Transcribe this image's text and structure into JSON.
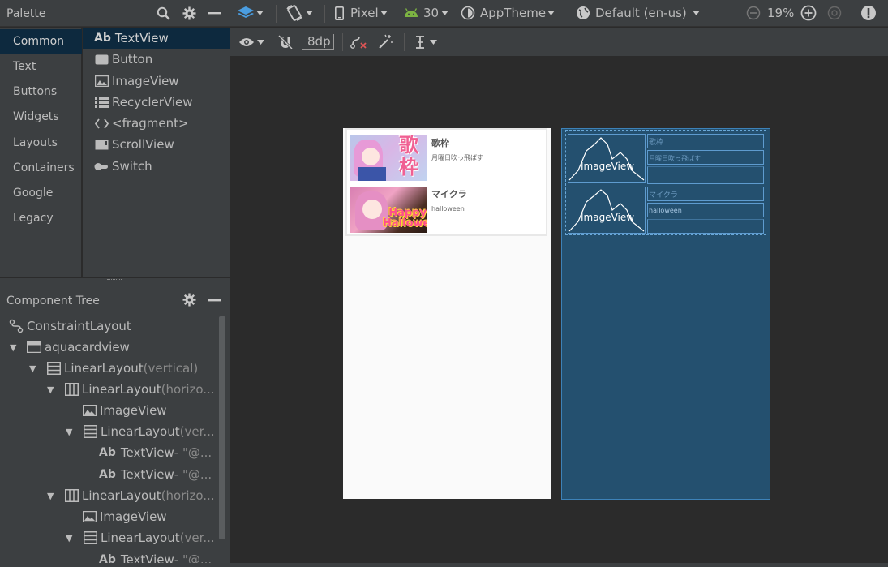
{
  "palette": {
    "title": "Palette",
    "categories": [
      "Common",
      "Text",
      "Buttons",
      "Widgets",
      "Layouts",
      "Containers",
      "Google",
      "Legacy"
    ],
    "items": [
      {
        "icon": "textview-icon",
        "prefix": "Ab",
        "label": "TextView"
      },
      {
        "icon": "button-icon",
        "label": "Button"
      },
      {
        "icon": "imageview-icon",
        "label": "ImageView"
      },
      {
        "icon": "recyclerview-icon",
        "label": "RecyclerView"
      },
      {
        "icon": "fragment-icon",
        "label": "<fragment>"
      },
      {
        "icon": "scrollview-icon",
        "label": "ScrollView"
      },
      {
        "icon": "switch-icon",
        "label": "Switch"
      }
    ]
  },
  "component_tree": {
    "title": "Component Tree",
    "rows": [
      {
        "label": "ConstraintLayout",
        "dim": ""
      },
      {
        "label": "aquacardview",
        "dim": ""
      },
      {
        "label": "LinearLayout",
        "dim": "(vertical)"
      },
      {
        "label": "LinearLayout",
        "dim": "(horizo..."
      },
      {
        "label": "ImageView",
        "dim": ""
      },
      {
        "label": "LinearLayout",
        "dim": "(ver..."
      },
      {
        "label": "TextView",
        "dim": "- \"@..."
      },
      {
        "label": "TextView",
        "dim": "- \"@..."
      },
      {
        "label": "LinearLayout",
        "dim": "(horizo..."
      },
      {
        "label": "ImageView",
        "dim": ""
      },
      {
        "label": "LinearLayout",
        "dim": "(ver..."
      },
      {
        "label": "TextView",
        "dim": "- \"@..."
      }
    ],
    "text_prefix": "Ab"
  },
  "toolbar": {
    "device": "Pixel",
    "api": "30",
    "theme": "AppTheme",
    "locale": "Default (en-us)",
    "zoom": "19%",
    "margin": "8dp"
  },
  "preview": {
    "cards": [
      {
        "title": "歌枠",
        "subtitle": "月曜日吹っ飛ばす",
        "thumb_text": "歌\n枠"
      },
      {
        "title": "マイクラ",
        "subtitle": "halloween",
        "thumb_text": "Happy\nHalloween"
      }
    ]
  },
  "blueprint": {
    "image_label": "ImageView",
    "cards": [
      {
        "title": "歌枠",
        "subtitle": "月曜日吹っ飛ばす"
      },
      {
        "title": "マイクラ",
        "subtitle": "halloween"
      }
    ]
  },
  "colors": {
    "panel": "#3c3f41",
    "canvas": "#2b2b2b",
    "selection": "#0d293e",
    "blueprint": "#24506f"
  }
}
